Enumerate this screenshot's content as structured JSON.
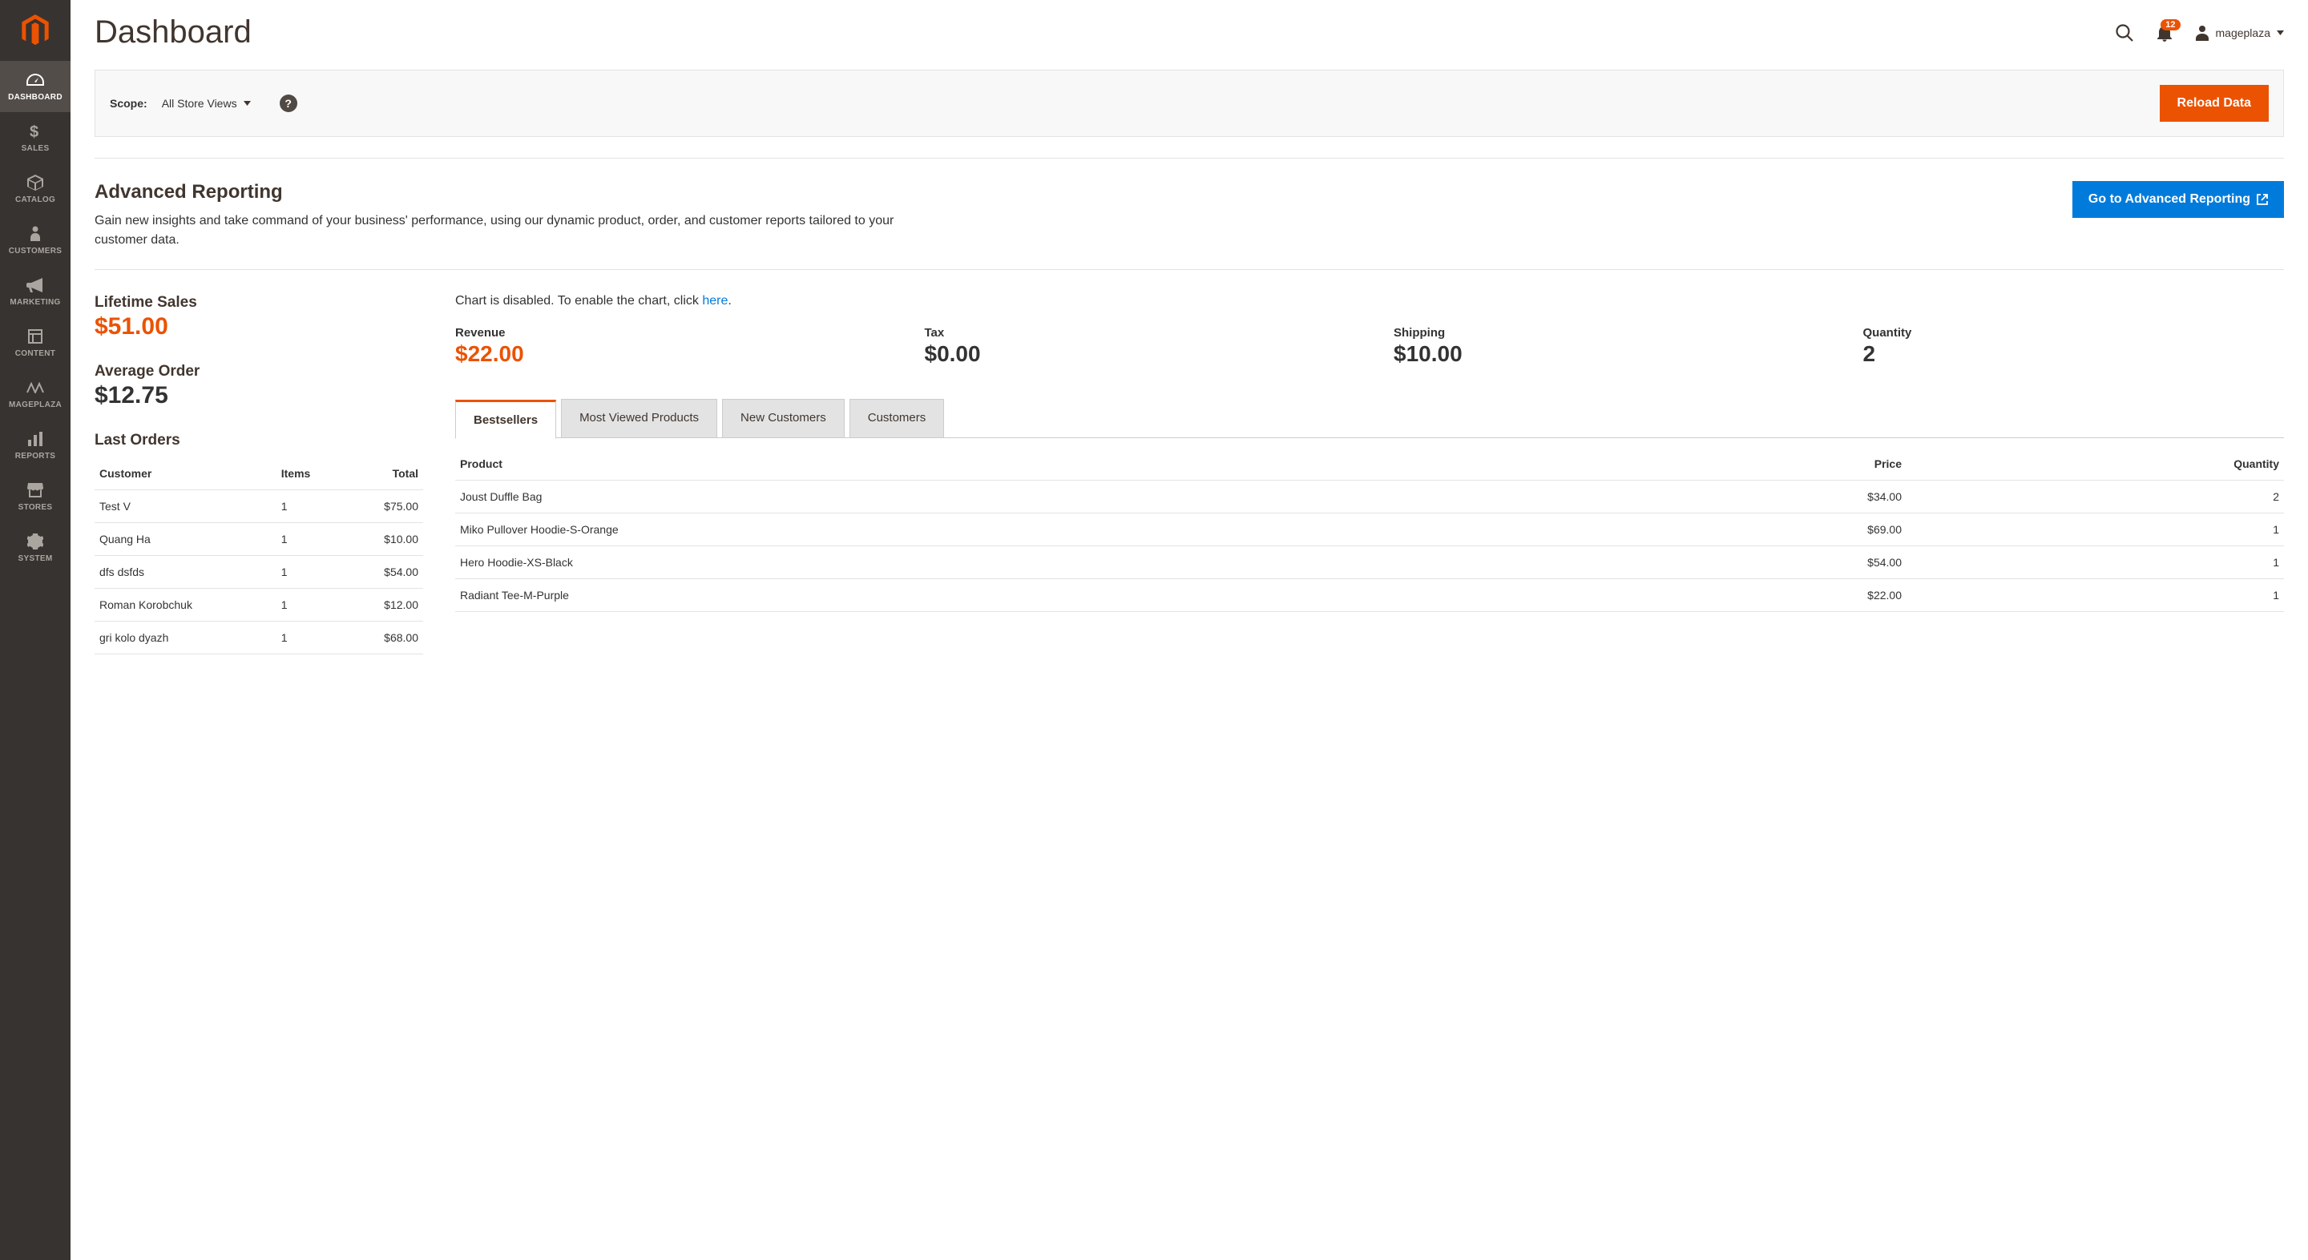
{
  "header": {
    "title": "Dashboard",
    "notification_count": "12",
    "username": "mageplaza"
  },
  "toolbar": {
    "scope_label": "Scope:",
    "scope_value": "All Store Views",
    "reload_btn": "Reload Data"
  },
  "nav": [
    {
      "label": "DASHBOARD"
    },
    {
      "label": "SALES"
    },
    {
      "label": "CATALOG"
    },
    {
      "label": "CUSTOMERS"
    },
    {
      "label": "MARKETING"
    },
    {
      "label": "CONTENT"
    },
    {
      "label": "MAGEPLAZA"
    },
    {
      "label": "REPORTS"
    },
    {
      "label": "STORES"
    },
    {
      "label": "SYSTEM"
    }
  ],
  "advanced": {
    "title": "Advanced Reporting",
    "description": "Gain new insights and take command of your business' performance, using our dynamic product, order, and customer reports tailored to your customer data.",
    "button": "Go to Advanced Reporting"
  },
  "lifetime_sales": {
    "label": "Lifetime Sales",
    "value": "$51.00"
  },
  "average_order": {
    "label": "Average Order",
    "value": "$12.75"
  },
  "last_orders": {
    "title": "Last Orders",
    "columns": {
      "customer": "Customer",
      "items": "Items",
      "total": "Total"
    },
    "rows": [
      {
        "customer": "Test V",
        "items": "1",
        "total": "$75.00"
      },
      {
        "customer": "Quang Ha",
        "items": "1",
        "total": "$10.00"
      },
      {
        "customer": "dfs dsfds",
        "items": "1",
        "total": "$54.00"
      },
      {
        "customer": "Roman Korobchuk",
        "items": "1",
        "total": "$12.00"
      },
      {
        "customer": "gri kolo dyazh",
        "items": "1",
        "total": "$68.00"
      }
    ]
  },
  "chart_notice": {
    "prefix": "Chart is disabled. To enable the chart, click ",
    "link": "here",
    "suffix": "."
  },
  "metrics": {
    "revenue": {
      "label": "Revenue",
      "value": "$22.00"
    },
    "tax": {
      "label": "Tax",
      "value": "$0.00"
    },
    "shipping": {
      "label": "Shipping",
      "value": "$10.00"
    },
    "quantity": {
      "label": "Quantity",
      "value": "2"
    }
  },
  "tabs": [
    {
      "label": "Bestsellers"
    },
    {
      "label": "Most Viewed Products"
    },
    {
      "label": "New Customers"
    },
    {
      "label": "Customers"
    }
  ],
  "bestsellers": {
    "columns": {
      "product": "Product",
      "price": "Price",
      "quantity": "Quantity"
    },
    "rows": [
      {
        "product": "Joust Duffle Bag",
        "price": "$34.00",
        "quantity": "2"
      },
      {
        "product": "Miko Pullover Hoodie-S-Orange",
        "price": "$69.00",
        "quantity": "1"
      },
      {
        "product": "Hero Hoodie-XS-Black",
        "price": "$54.00",
        "quantity": "1"
      },
      {
        "product": "Radiant Tee-M-Purple",
        "price": "$22.00",
        "quantity": "1"
      }
    ]
  }
}
